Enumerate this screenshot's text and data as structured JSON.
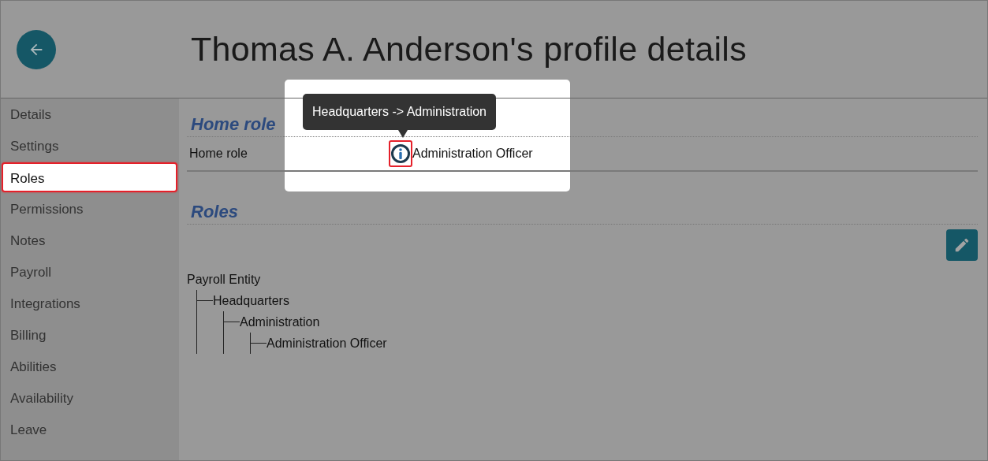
{
  "header": {
    "title": "Thomas A. Anderson's profile details"
  },
  "sidebar": {
    "items": [
      {
        "label": "Details",
        "selected": false
      },
      {
        "label": "Settings",
        "selected": false
      },
      {
        "label": "Roles",
        "selected": true
      },
      {
        "label": "Permissions",
        "selected": false
      },
      {
        "label": "Notes",
        "selected": false
      },
      {
        "label": "Payroll",
        "selected": false
      },
      {
        "label": "Integrations",
        "selected": false
      },
      {
        "label": "Billing",
        "selected": false
      },
      {
        "label": "Abilities",
        "selected": false
      },
      {
        "label": "Availability",
        "selected": false
      },
      {
        "label": "Leave",
        "selected": false
      }
    ]
  },
  "home_role": {
    "heading": "Home role",
    "rows": [
      {
        "label": "Home role",
        "value": "Administration Officer",
        "highlighted": true,
        "tooltip": "Headquarters -> Administration"
      }
    ]
  },
  "roles": {
    "heading": "Roles",
    "tree": [
      {
        "label": "Payroll Entity",
        "children": [
          {
            "label": "Headquarters",
            "children": [
              {
                "label": "Administration",
                "children": [
                  {
                    "label": "Administration Officer"
                  }
                ]
              }
            ]
          }
        ]
      }
    ]
  }
}
